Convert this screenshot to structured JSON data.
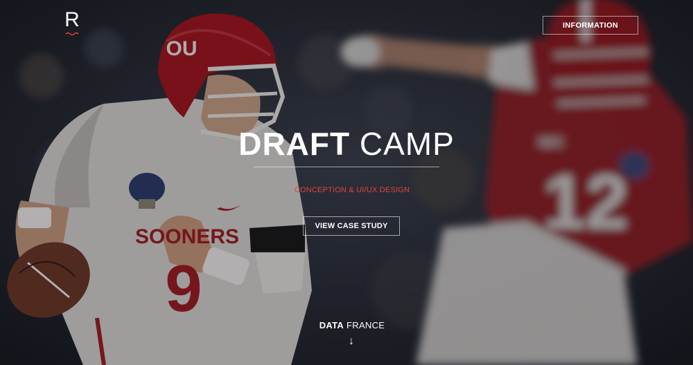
{
  "logo": {
    "letter": "R"
  },
  "nav": {
    "information_label": "INFORMATION"
  },
  "hero": {
    "title_bold": "DRAFT",
    "title_light": "CAMP",
    "subtitle": "CONCEPTION & UI/UX DESIGN",
    "cta_label": "VIEW CASE STUDY",
    "caption_bold": "DATA",
    "caption_light": "FRANCE",
    "arrow_glyph": "↓"
  },
  "colors": {
    "accent": "#e0453b",
    "crimson": "#9e1b22",
    "white_jersey": "#e9e6e3"
  },
  "photo": {
    "helmet_logo": "OU",
    "jersey_text": "SOONERS",
    "number_left": "9",
    "number_right": "12",
    "patch_text": "SEC"
  },
  "icons": [
    "logo-mark-icon",
    "down-arrow-icon"
  ]
}
